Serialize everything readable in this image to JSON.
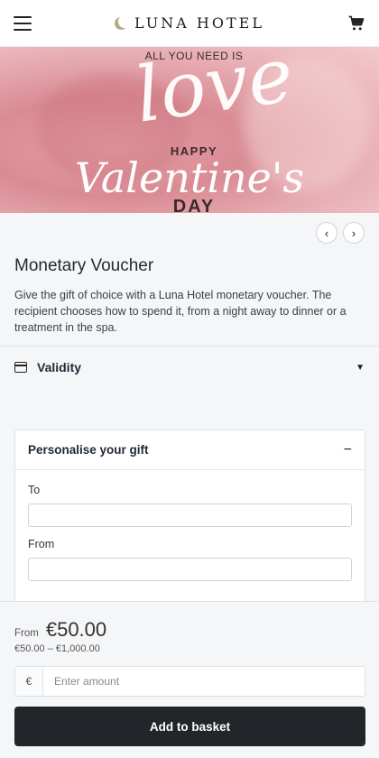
{
  "header": {
    "brand": "LUNA HOTEL",
    "menu_icon": "hamburger-icon",
    "cart_icon": "cart-icon",
    "logo_icon": "crescent-moon-icon"
  },
  "hero": {
    "line1": "ALL YOU NEED IS",
    "script1": "love",
    "line2": "HAPPY",
    "script2": "Valentine's",
    "line3": "DAY"
  },
  "carousel": {
    "prev_label": "‹",
    "next_label": "›"
  },
  "product": {
    "title": "Monetary Voucher",
    "description": "Give the gift of choice with a Luna Hotel monetary voucher. The recipient chooses how to spend it, from a night away to dinner or a treatment in the spa."
  },
  "validity": {
    "label": "Validity",
    "caret": "▼",
    "icon": "calendar-icon"
  },
  "personalise": {
    "title": "Personalise your gift",
    "toggle": "−",
    "to_label": "To",
    "from_label": "From",
    "to_value": "",
    "from_value": ""
  },
  "pricing": {
    "from_label": "From",
    "price": "€50.00",
    "range": "€50.00 – €1,000.00",
    "currency_symbol": "€",
    "amount_placeholder": "Enter amount",
    "add_button": "Add to basket"
  },
  "colors": {
    "button_bg": "#22262b",
    "page_bg": "#f5f6f8",
    "hero_pink": "#d98b93"
  }
}
